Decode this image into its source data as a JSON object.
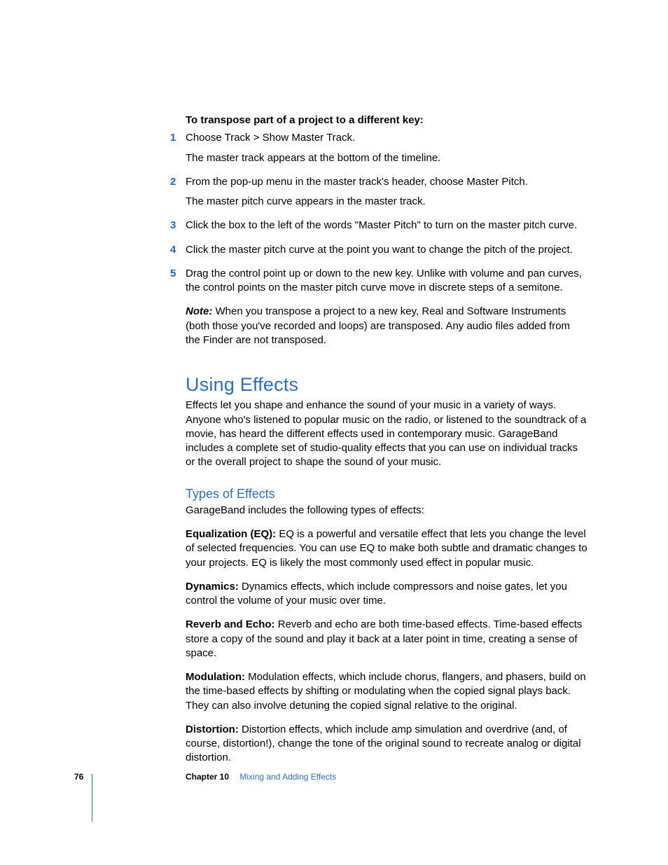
{
  "task": {
    "heading": "To transpose part of a project to a different key:",
    "steps": [
      {
        "num": "1",
        "text": "Choose Track > Show Master Track.",
        "sub": "The master track appears at the bottom of the timeline."
      },
      {
        "num": "2",
        "text": "From the pop-up menu in the master track's header, choose Master Pitch.",
        "sub": "The master pitch curve appears in the master track."
      },
      {
        "num": "3",
        "text": "Click the box to the left of the words \"Master Pitch\" to turn on the master pitch curve."
      },
      {
        "num": "4",
        "text": "Click the master pitch curve at the point you want to change the pitch of the project."
      },
      {
        "num": "5",
        "text": "Drag the control point up or down to the new key. Unlike with volume and pan curves, the control points on the master pitch curve move in discrete steps of a semitone."
      }
    ],
    "note_label": "Note:",
    "note_text": "  When you transpose a project to a new key, Real and Software Instruments (both those you've recorded and loops) are transposed. Any audio files added from the Finder are not transposed."
  },
  "section": {
    "h1": "Using Effects",
    "intro": "Effects let you shape and enhance the sound of your music in a variety of ways. Anyone who's listened to popular music on the radio, or listened to the soundtrack of a movie, has heard the different effects used in contemporary music. GarageBand includes a complete set of studio-quality effects that you can use on individual tracks or the overall project to shape the sound of your music.",
    "h2": "Types of Effects",
    "types_intro": "GarageBand includes the following types of effects:",
    "effects": [
      {
        "label": "Equalization (EQ):",
        "text": "  EQ is a powerful and versatile effect that lets you change the level of selected frequencies. You can use EQ to make both subtle and dramatic changes to your projects. EQ is likely the most commonly used effect in popular music."
      },
      {
        "label": "Dynamics:",
        "text": "  Dynamics effects, which include compressors and noise gates, let you control the volume of your music over time."
      },
      {
        "label": "Reverb and Echo:",
        "text": "  Reverb and echo are both time-based effects. Time-based effects store a copy of the sound and play it back at a later point in time, creating a sense of space."
      },
      {
        "label": "Modulation:",
        "text": "  Modulation effects, which include chorus, flangers, and phasers, build on the time-based effects by shifting or modulating when the copied signal plays back. They can also involve detuning the copied signal relative to the original."
      },
      {
        "label": "Distortion:",
        "text": "  Distortion effects, which include amp simulation and overdrive (and, of course, distortion!), change the tone of the original sound to recreate analog or digital distortion."
      }
    ]
  },
  "footer": {
    "page": "76",
    "chapter_label": "Chapter 10",
    "chapter_title": "Mixing and Adding Effects"
  }
}
